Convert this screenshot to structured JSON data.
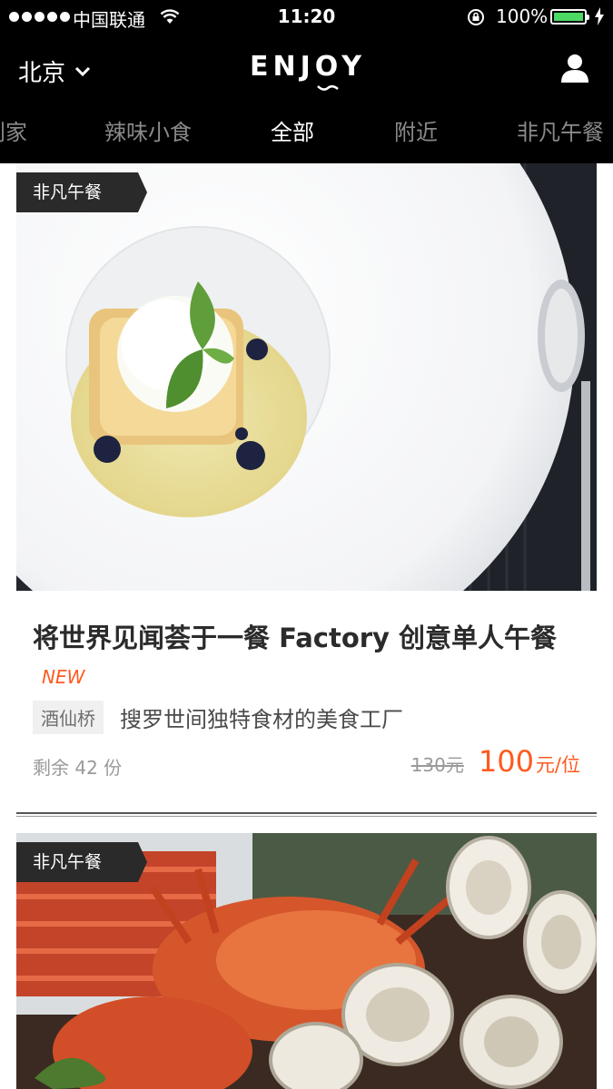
{
  "status_bar": {
    "carrier": "中国联通",
    "time": "11:20",
    "battery_percent": "100%",
    "battery_level": 1.0,
    "battery_color": "#4cd964"
  },
  "header": {
    "city": "北京",
    "logo": "ENJOY",
    "icons": [
      "chevron-down-icon",
      "user-icon"
    ]
  },
  "tabs": [
    {
      "label": "别家",
      "active": false
    },
    {
      "label": "辣味小食",
      "active": false
    },
    {
      "label": "全部",
      "active": true
    },
    {
      "label": "附近",
      "active": false
    },
    {
      "label": "非凡午餐",
      "active": false
    }
  ],
  "feed": [
    {
      "tag": "非凡午餐",
      "title": "将世界见闻荟于一餐 Factory 创意单人午餐",
      "new_label": "NEW",
      "location": "酒仙桥",
      "description": "搜罗世间独特食材的美食工厂",
      "remaining": "剩余 42 份",
      "original_price": "130元",
      "price": "100",
      "price_unit": "元/位"
    },
    {
      "tag": "非凡午餐"
    }
  ],
  "colors": {
    "accent": "#ff5a1f",
    "header_bg": "#000000"
  }
}
